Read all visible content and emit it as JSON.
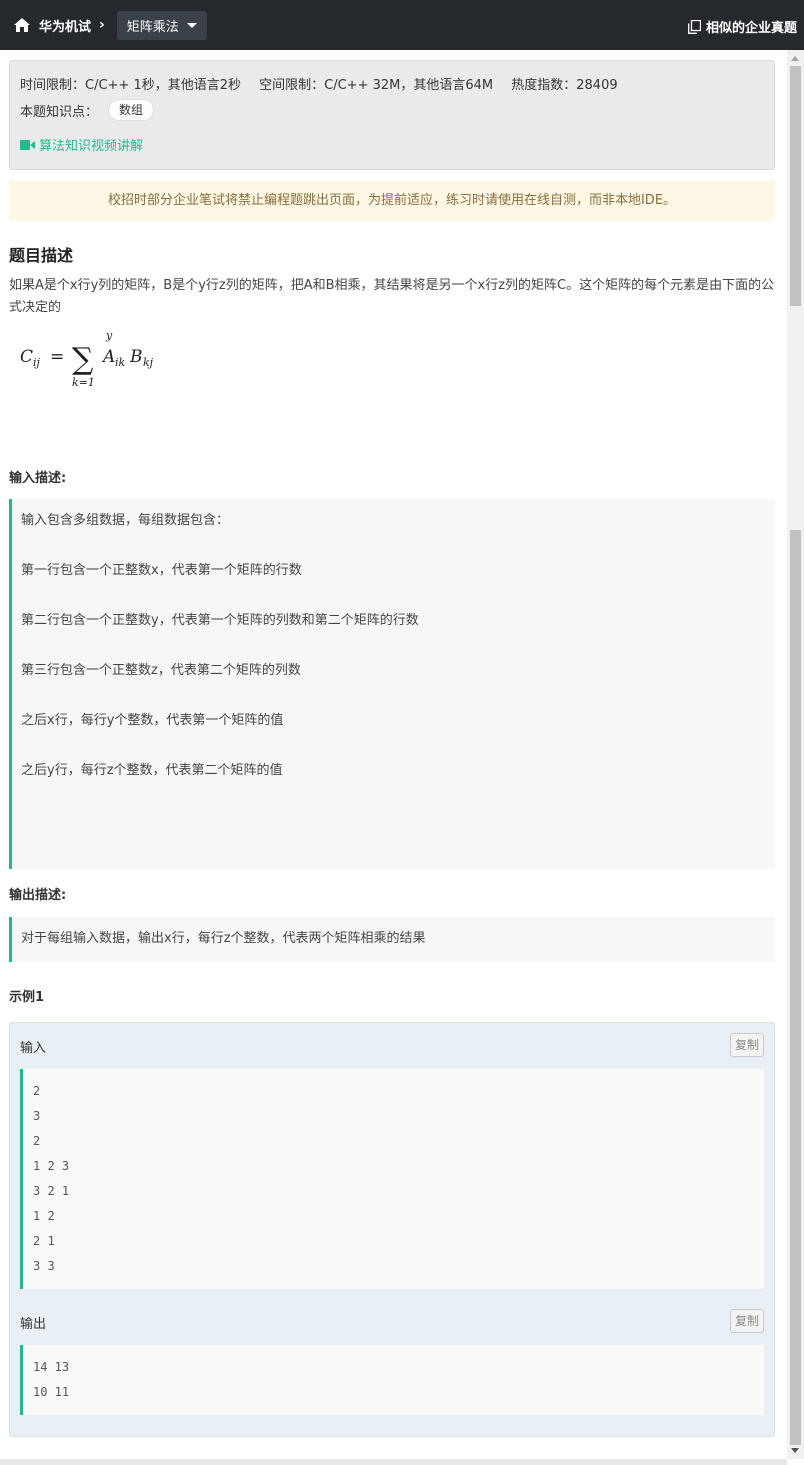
{
  "topbar": {
    "home_label": "华为机试",
    "problem_title": "矩阵乘法",
    "similar_label": "相似的企业真题"
  },
  "info": {
    "time_limit": "时间限制：C/C++ 1秒，其他语言2秒",
    "space_limit": "空间限制：C/C++ 32M，其他语言64M",
    "heat": "热度指数：28409",
    "knowledge_label": "本题知识点：",
    "tag": "数组",
    "video_link": "算法知识视频讲解"
  },
  "notice": "校招时部分企业笔试将禁止编程题跳出页面，为提前适应，练习时请使用在线自测，而非本地IDE。",
  "description": {
    "heading": "题目描述",
    "text": "如果A是个x行y列的矩阵，B是个y行z列的矩阵，把A和B相乘，其结果将是另一个x行z列的矩阵C。这个矩阵的每个元素是由下面的公式决定的"
  },
  "input_desc": {
    "label": "输入描述:",
    "lines": [
      "输入包含多组数据，每组数据包含：",
      "第一行包含一个正整数x，代表第一个矩阵的行数",
      "第二行包含一个正整数y，代表第一个矩阵的列数和第二个矩阵的行数",
      "第三行包含一个正整数z，代表第二个矩阵的列数",
      "之后x行，每行y个整数，代表第一个矩阵的值",
      "之后y行，每行z个整数，代表第二个矩阵的值"
    ]
  },
  "output_desc": {
    "label": "输出描述:",
    "text": "对于每组输入数据，输出x行，每行z个整数，代表两个矩阵相乘的结果"
  },
  "example": {
    "label": "示例1",
    "input_label": "输入",
    "output_label": "输出",
    "copy_label": "复制",
    "input_lines": [
      "2",
      "3",
      "2",
      "1 2 3",
      "3 2 1",
      "1 2",
      "2 1",
      "3 3"
    ],
    "output_lines": [
      "14 13",
      "10 11"
    ]
  },
  "colors": {
    "accent": "#23b98e",
    "topbar": "#25292e"
  },
  "icons": [
    "home-icon",
    "copy-icon",
    "video-icon"
  ]
}
